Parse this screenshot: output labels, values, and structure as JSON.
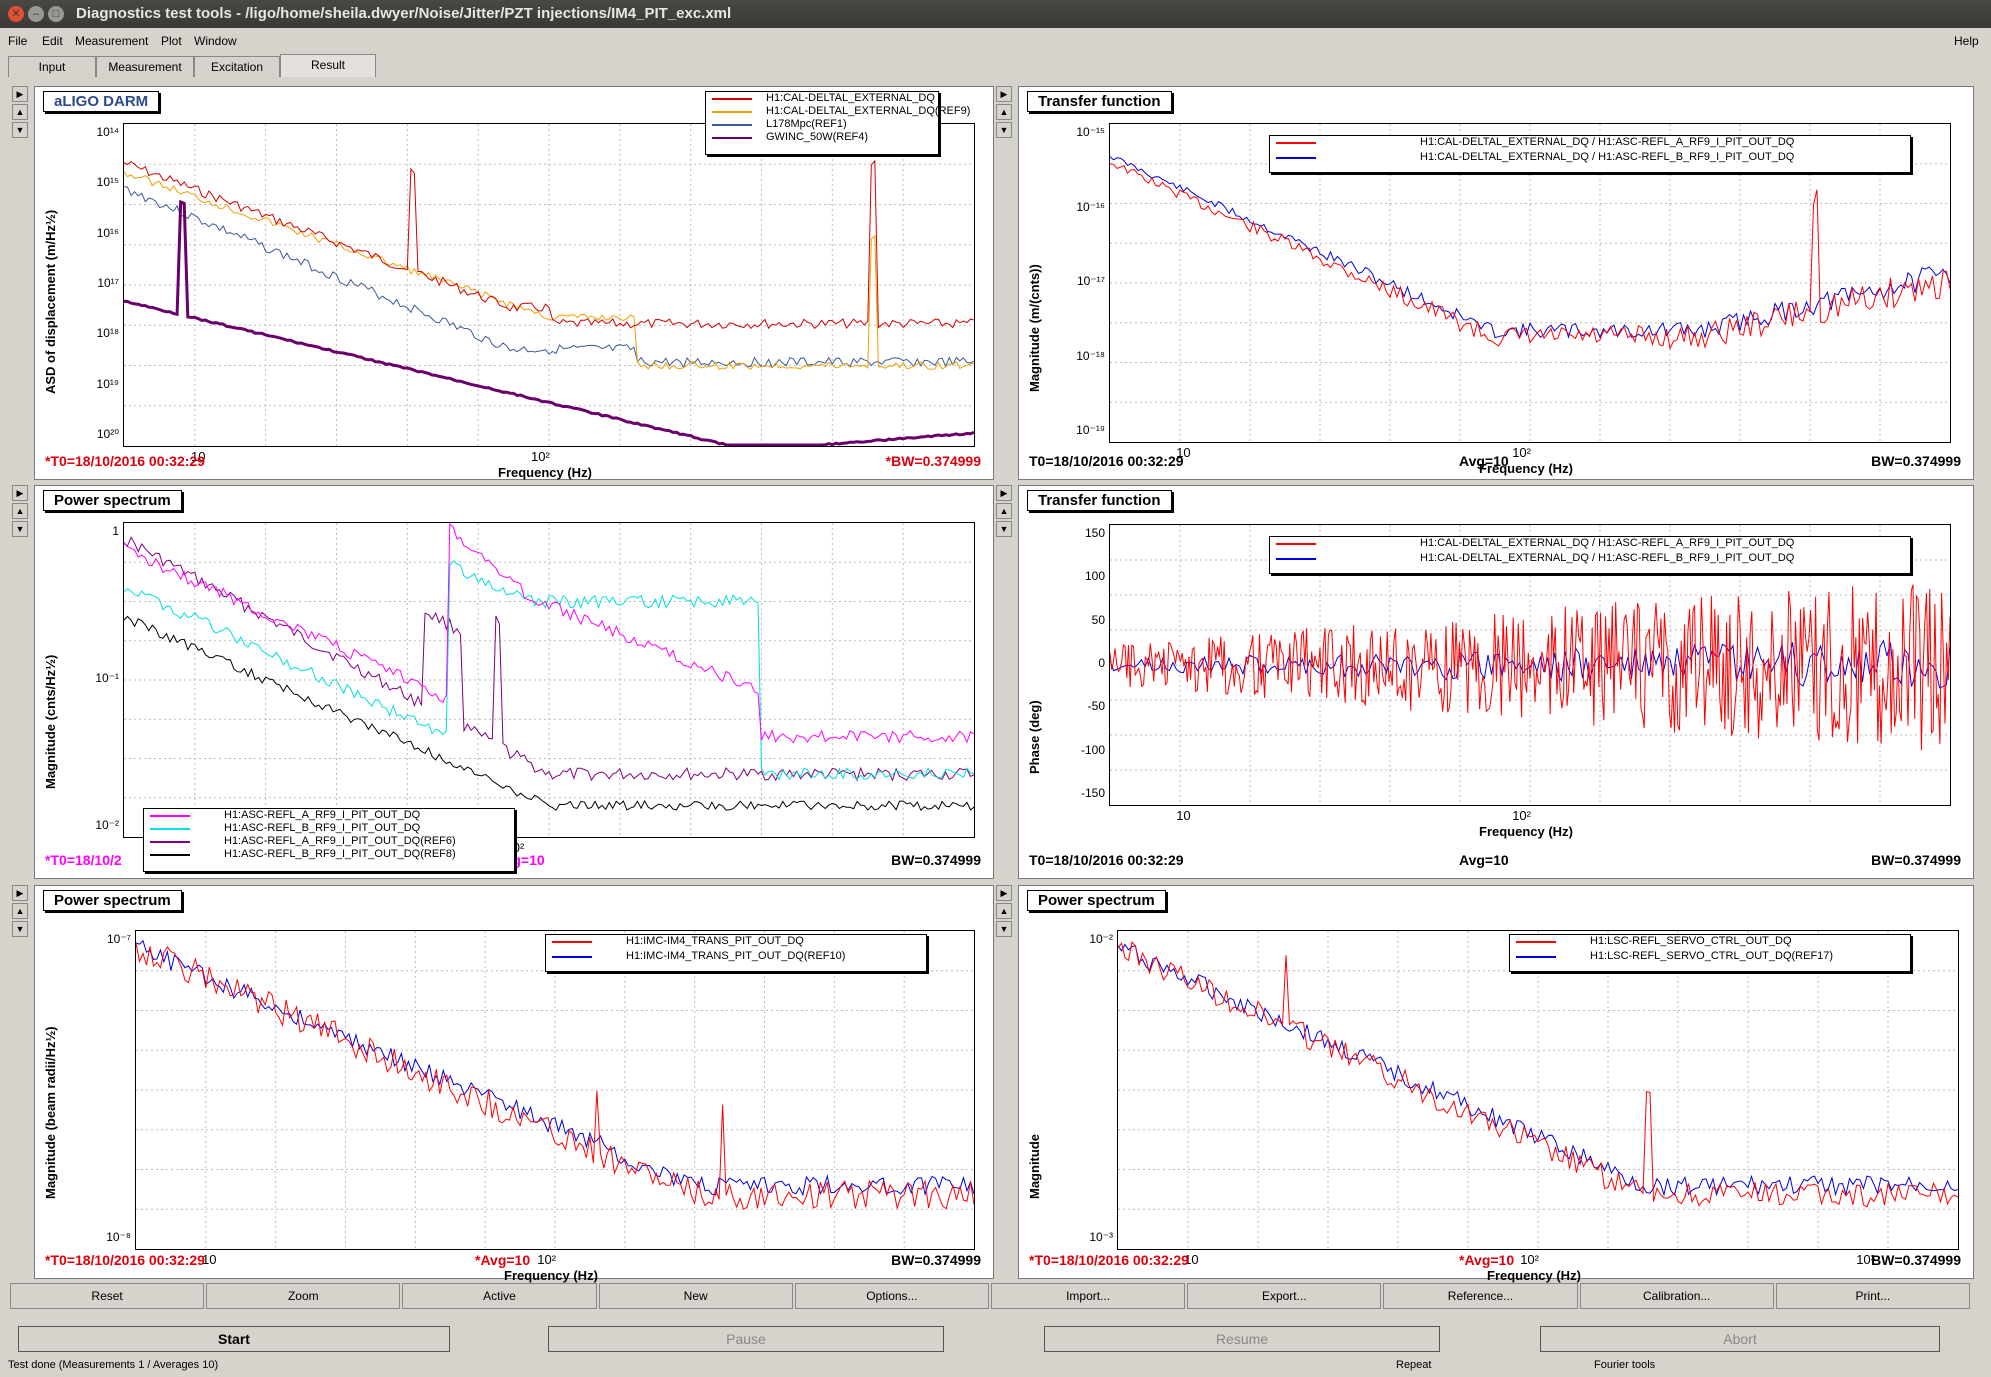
{
  "window": {
    "title": "Diagnostics test tools - /ligo/home/sheila.dwyer/Noise/Jitter/PZT injections/IM4_PIT_exc.xml",
    "help": "Help"
  },
  "menu": [
    "File",
    "Edit",
    "Measurement",
    "Plot",
    "Window"
  ],
  "tabs": [
    "Input",
    "Measurement",
    "Excitation",
    "Result"
  ],
  "panes": [
    {
      "title": "aLIGO DARM",
      "ylabel": "ASD of displacement (m/Hz½)",
      "xlabel": "Frequency (Hz)",
      "xticks": [
        "10",
        "10²"
      ],
      "yticks": [
        "10¹⁴",
        "10¹⁵",
        "10¹⁶",
        "10¹⁷",
        "10¹⁸",
        "10¹⁹",
        "10²⁰"
      ],
      "foot_left": "*T0=18/10/2016 00:32:29",
      "foot_mid": "",
      "foot_right": "*BW=0.374999",
      "legend": [
        {
          "label": "H1:CAL-DELTAL_EXTERNAL_DQ",
          "color": "#d40000"
        },
        {
          "label": "H1:CAL-DELTAL_EXTERNAL_DQ(REF9)",
          "color": "#f0a000"
        },
        {
          "label": "L178Mpc(REF1)",
          "color": "#3a5a9a"
        },
        {
          "label": "GWINC_50W(REF4)",
          "color": "#6a006a"
        }
      ]
    },
    {
      "title": "Transfer function",
      "ylabel": "Magnitude (m/(cnts))",
      "xlabel": "Frequency (Hz)",
      "xticks": [
        "10",
        "10²"
      ],
      "yticks": [
        "10⁻¹⁵",
        "10⁻¹⁶",
        "10⁻¹⁷",
        "10⁻¹⁸",
        "10⁻¹⁹"
      ],
      "foot_left": "T0=18/10/2016 00:32:29",
      "foot_mid": "Avg=10",
      "foot_right": "BW=0.374999",
      "legend": [
        {
          "label": "H1:CAL-DELTAL_EXTERNAL_DQ / H1:ASC-REFL_A_RF9_I_PIT_OUT_DQ",
          "color": "#ff0000"
        },
        {
          "label": "H1:CAL-DELTAL_EXTERNAL_DQ / H1:ASC-REFL_B_RF9_I_PIT_OUT_DQ",
          "color": "#0000e0"
        }
      ]
    },
    {
      "title": "Power spectrum",
      "ylabel": "Magnitude (cnts/Hz½)",
      "xlabel": "",
      "xticks": [
        "10²"
      ],
      "yticks": [
        "1",
        "10⁻¹",
        "10⁻²"
      ],
      "foot_left": "*T0=18/10/2",
      "foot_mid": "Avg=10",
      "foot_right": "BW=0.374999",
      "legend": [
        {
          "label": "H1:ASC-REFL_A_RF9_I_PIT_OUT_DQ",
          "color": "#ff00ff"
        },
        {
          "label": "H1:ASC-REFL_B_RF9_I_PIT_OUT_DQ",
          "color": "#00e0e0"
        },
        {
          "label": "H1:ASC-REFL_A_RF9_I_PIT_OUT_DQ(REF6)",
          "color": "#800080"
        },
        {
          "label": "H1:ASC-REFL_B_RF9_I_PIT_OUT_DQ(REF8)",
          "color": "#000000"
        }
      ]
    },
    {
      "title": "Transfer function",
      "ylabel": "Phase (deg)",
      "xlabel": "Frequency (Hz)",
      "xticks": [
        "10",
        "10²"
      ],
      "yticks": [
        "150",
        "100",
        "50",
        "0",
        "-50",
        "-100",
        "-150"
      ],
      "foot_left": "T0=18/10/2016 00:32:29",
      "foot_mid": "Avg=10",
      "foot_right": "BW=0.374999",
      "legend": [
        {
          "label": "H1:CAL-DELTAL_EXTERNAL_DQ / H1:ASC-REFL_A_RF9_I_PIT_OUT_DQ",
          "color": "#ff0000"
        },
        {
          "label": "H1:CAL-DELTAL_EXTERNAL_DQ / H1:ASC-REFL_B_RF9_I_PIT_OUT_DQ",
          "color": "#0000e0"
        }
      ]
    },
    {
      "title": "Power spectrum",
      "ylabel": "Magnitude (beam radii/Hz½)",
      "xlabel": "Frequency (Hz)",
      "xticks": [
        "10",
        "10²"
      ],
      "yticks": [
        "10⁻⁷",
        "10⁻⁸"
      ],
      "foot_left": "*T0=18/10/2016 00:32:29",
      "foot_mid": "*Avg=10",
      "foot_right": "BW=0.374999",
      "legend": [
        {
          "label": "H1:IMC-IM4_TRANS_PIT_OUT_DQ",
          "color": "#ff0000"
        },
        {
          "label": "H1:IMC-IM4_TRANS_PIT_OUT_DQ(REF10)",
          "color": "#0000e0"
        }
      ]
    },
    {
      "title": "Power spectrum",
      "ylabel": "Magnitude",
      "xlabel": "Frequency (Hz)",
      "xticks": [
        "10",
        "10²",
        "10³"
      ],
      "yticks": [
        "10⁻²",
        "10⁻³"
      ],
      "foot_left": "*T0=18/10/2016 00:32:29",
      "foot_mid": "*Avg=10",
      "foot_right": "BW=0.374999",
      "legend": [
        {
          "label": "H1:LSC-REFL_SERVO_CTRL_OUT_DQ",
          "color": "#ff0000"
        },
        {
          "label": "H1:LSC-REFL_SERVO_CTRL_OUT_DQ(REF17)",
          "color": "#0000e0"
        }
      ]
    }
  ],
  "bottom_buttons": [
    "Reset",
    "Zoom",
    "Active",
    "New",
    "Options...",
    "Import...",
    "Export...",
    "Reference...",
    "Calibration...",
    "Print..."
  ],
  "control_buttons": [
    "Start",
    "Pause",
    "Resume",
    "Abort"
  ],
  "status": {
    "left": "Test done (Measurements 1 / Averages 10)",
    "mid": "Repeat",
    "right": "Fourier tools"
  }
}
